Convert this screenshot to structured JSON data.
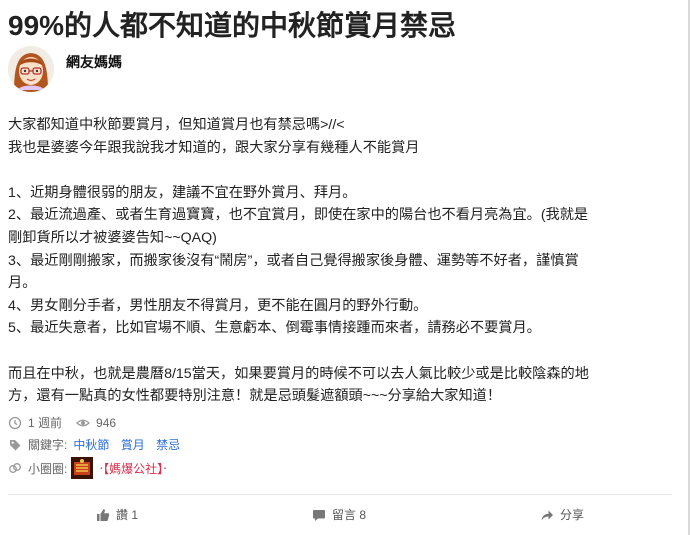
{
  "post": {
    "title": "99%的人都不知道的中秋節賞月禁忌",
    "author": "網友媽媽",
    "paragraphs": [
      "大家都知道中秋節要賞月，但知道賞月也有禁忌嗎>//<",
      "我也是婆婆今年跟我說我才知道的，跟大家分享有幾種人不能賞月",
      "",
      "1、近期身體很弱的朋友，建議不宜在野外賞月、拜月。",
      "2、最近流過產、或者生育過寶寶，也不宜賞月，即使在家中的陽台也不看月亮為宜。(我就是",
      "剛卸貨所以才被婆婆告知~~QAQ)",
      "3、最近剛剛搬家，而搬家後沒有“鬧房”，或者自己覺得搬家後身體、運勢等不好者，謹慎賞",
      "月。",
      "4、男女剛分手者，男性朋友不得賞月，更不能在圓月的野外行動。",
      "5、最近失意者，比如官場不順、生意虧本、倒霉事情接踵而來者，請務必不要賞月。",
      "",
      "而且在中秋，也就是農曆8/15當天，如果要賞月的時候不可以去人氣比較少或是比較陰森的地",
      "方，還有一點真的女性都要特別注意！就是忌頭髮遮額頭~~~分享給大家知道！"
    ]
  },
  "meta": {
    "time": "1 週前",
    "views": "946",
    "keywords_label": "關鍵字:",
    "keywords": [
      "中秋節",
      "賞月",
      "禁忌"
    ],
    "circle_label": "小圈圈:",
    "circle_name": "‧【媽爆公社】‧"
  },
  "actions": {
    "like": "讚 1",
    "comment": "留言 8",
    "share": "分享"
  },
  "colors": {
    "link": "#2e6fd8",
    "circle": "#d6304c"
  }
}
